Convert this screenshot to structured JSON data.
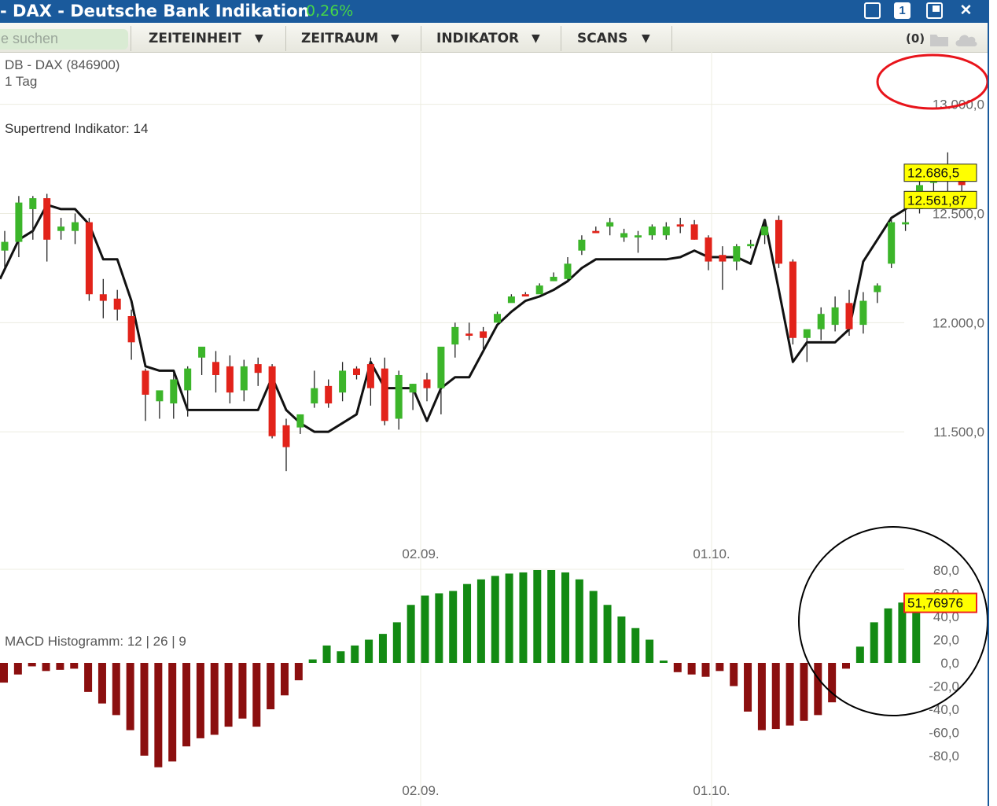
{
  "window": {
    "title": "- DAX - Deutsche Bank Indikation",
    "change": "0,26%",
    "btn_one": "1",
    "btn_close": "✕"
  },
  "toolbar": {
    "search_placeholder": "e suchen",
    "menu": [
      {
        "label": "ZEITEINHEIT",
        "arrow": "▼"
      },
      {
        "label": "ZEITRAUM",
        "arrow": "▼"
      },
      {
        "label": "INDIKATOR",
        "arrow": "▼"
      },
      {
        "label": "SCANS",
        "arrow": "▼"
      }
    ],
    "count": "(0)",
    "icons": [
      "folder-icon",
      "cloud-icon"
    ]
  },
  "colors": {
    "title_bar": "#1a5a9c",
    "up_candle": "#3cb52a",
    "down_candle": "#e2231a",
    "price_label": "#ffff00",
    "macd_positive": "#138a13",
    "macd_negative": "#8b0f0f",
    "annotation_red": "#e8141b",
    "annotation_black": "#000000"
  },
  "chart_data": [
    {
      "type": "candlestick",
      "title": "DB - DAX (846900)",
      "interval": "1 Tag",
      "indicator_label": "Supertrend Indikator: 14",
      "x_ticks": [
        "02.09.",
        "01.10."
      ],
      "y_ticks": [
        "13.000,0",
        "12.500,0",
        "12.000,0",
        "11.500,0"
      ],
      "ylim": [
        11000,
        13150
      ],
      "grid": true,
      "last_price_labels": [
        "12.686,5",
        "12.561,87"
      ],
      "candles": [
        {
          "o": 12330,
          "h": 12420,
          "l": 12250,
          "c": 12370
        },
        {
          "o": 12370,
          "h": 12580,
          "l": 12300,
          "c": 12550
        },
        {
          "o": 12520,
          "h": 12580,
          "l": 12380,
          "c": 12570
        },
        {
          "o": 12570,
          "h": 12590,
          "l": 12280,
          "c": 12380
        },
        {
          "o": 12420,
          "h": 12480,
          "l": 12380,
          "c": 12440
        },
        {
          "o": 12420,
          "h": 12500,
          "l": 12360,
          "c": 12460
        },
        {
          "o": 12460,
          "h": 12480,
          "l": 12100,
          "c": 12130
        },
        {
          "o": 12130,
          "h": 12200,
          "l": 12020,
          "c": 12100
        },
        {
          "o": 12110,
          "h": 12150,
          "l": 12010,
          "c": 12060
        },
        {
          "o": 12030,
          "h": 12060,
          "l": 11830,
          "c": 11910
        },
        {
          "o": 11780,
          "h": 11790,
          "l": 11550,
          "c": 11670
        },
        {
          "o": 11640,
          "h": 11680,
          "l": 11560,
          "c": 11690
        },
        {
          "o": 11630,
          "h": 11770,
          "l": 11560,
          "c": 11740
        },
        {
          "o": 11690,
          "h": 11800,
          "l": 11570,
          "c": 11790
        },
        {
          "o": 11840,
          "h": 11860,
          "l": 11760,
          "c": 11890
        },
        {
          "o": 11820,
          "h": 11870,
          "l": 11680,
          "c": 11760
        },
        {
          "o": 11800,
          "h": 11850,
          "l": 11630,
          "c": 11680
        },
        {
          "o": 11690,
          "h": 11830,
          "l": 11640,
          "c": 11800
        },
        {
          "o": 11810,
          "h": 11840,
          "l": 11710,
          "c": 11770
        },
        {
          "o": 11800,
          "h": 11810,
          "l": 11470,
          "c": 11480
        },
        {
          "o": 11530,
          "h": 11560,
          "l": 11320,
          "c": 11430
        },
        {
          "o": 11520,
          "h": 11580,
          "l": 11490,
          "c": 11580
        },
        {
          "o": 11630,
          "h": 11780,
          "l": 11610,
          "c": 11700
        },
        {
          "o": 11710,
          "h": 11740,
          "l": 11610,
          "c": 11630
        },
        {
          "o": 11680,
          "h": 11820,
          "l": 11640,
          "c": 11780
        },
        {
          "o": 11790,
          "h": 11800,
          "l": 11740,
          "c": 11760
        },
        {
          "o": 11810,
          "h": 11840,
          "l": 11620,
          "c": 11700
        },
        {
          "o": 11790,
          "h": 11840,
          "l": 11530,
          "c": 11550
        },
        {
          "o": 11560,
          "h": 11780,
          "l": 11510,
          "c": 11760
        },
        {
          "o": 11680,
          "h": 11720,
          "l": 11600,
          "c": 11720
        },
        {
          "o": 11740,
          "h": 11770,
          "l": 11640,
          "c": 11700
        },
        {
          "o": 11700,
          "h": 11720,
          "l": 11580,
          "c": 11890
        },
        {
          "o": 11900,
          "h": 12000,
          "l": 11840,
          "c": 11980
        },
        {
          "o": 11950,
          "h": 12000,
          "l": 11920,
          "c": 11940
        },
        {
          "o": 11960,
          "h": 11980,
          "l": 11870,
          "c": 11930
        },
        {
          "o": 12000,
          "h": 12050,
          "l": 12020,
          "c": 12040
        },
        {
          "o": 12090,
          "h": 12130,
          "l": 12110,
          "c": 12120
        },
        {
          "o": 12130,
          "h": 12140,
          "l": 12130,
          "c": 12120
        },
        {
          "o": 12130,
          "h": 12180,
          "l": 12140,
          "c": 12170
        },
        {
          "o": 12190,
          "h": 12230,
          "l": 12190,
          "c": 12210
        },
        {
          "o": 12200,
          "h": 12300,
          "l": 12190,
          "c": 12270
        },
        {
          "o": 12330,
          "h": 12400,
          "l": 12310,
          "c": 12380
        },
        {
          "o": 12420,
          "h": 12440,
          "l": 12410,
          "c": 12410
        },
        {
          "o": 12440,
          "h": 12480,
          "l": 12400,
          "c": 12460
        },
        {
          "o": 12390,
          "h": 12430,
          "l": 12370,
          "c": 12410
        },
        {
          "o": 12390,
          "h": 12420,
          "l": 12320,
          "c": 12400
        },
        {
          "o": 12400,
          "h": 12450,
          "l": 12380,
          "c": 12440
        },
        {
          "o": 12400,
          "h": 12460,
          "l": 12380,
          "c": 12440
        },
        {
          "o": 12450,
          "h": 12480,
          "l": 12410,
          "c": 12440
        },
        {
          "o": 12450,
          "h": 12470,
          "l": 12380,
          "c": 12380
        },
        {
          "o": 12390,
          "h": 12400,
          "l": 12240,
          "c": 12280
        },
        {
          "o": 12310,
          "h": 12350,
          "l": 12150,
          "c": 12280
        },
        {
          "o": 12280,
          "h": 12360,
          "l": 12240,
          "c": 12350
        },
        {
          "o": 12350,
          "h": 12380,
          "l": 12340,
          "c": 12360
        },
        {
          "o": 12400,
          "h": 12470,
          "l": 12360,
          "c": 12440
        },
        {
          "o": 12470,
          "h": 12490,
          "l": 12250,
          "c": 12270
        },
        {
          "o": 12280,
          "h": 12290,
          "l": 11900,
          "c": 11930
        },
        {
          "o": 11930,
          "h": 11960,
          "l": 11820,
          "c": 11970
        },
        {
          "o": 11970,
          "h": 12070,
          "l": 11920,
          "c": 12040
        },
        {
          "o": 11990,
          "h": 12120,
          "l": 11960,
          "c": 12070
        },
        {
          "o": 12090,
          "h": 12150,
          "l": 11940,
          "c": 11970
        },
        {
          "o": 11990,
          "h": 12140,
          "l": 11950,
          "c": 12100
        },
        {
          "o": 12140,
          "h": 12180,
          "l": 12090,
          "c": 12170
        },
        {
          "o": 12270,
          "h": 12480,
          "l": 12250,
          "c": 12460
        },
        {
          "o": 12450,
          "h": 12520,
          "l": 12420,
          "c": 12460
        },
        {
          "o": 12520,
          "h": 12660,
          "l": 12500,
          "c": 12630
        },
        {
          "o": 12640,
          "h": 12700,
          "l": 12560,
          "c": 12690
        },
        {
          "o": 12680,
          "h": 12780,
          "l": 12600,
          "c": 12700
        },
        {
          "o": 12690,
          "h": 12710,
          "l": 12580,
          "c": 12630
        }
      ],
      "supertrend": [
        12200,
        12380,
        12420,
        12540,
        12520,
        12520,
        12450,
        12290,
        12290,
        12100,
        11800,
        11780,
        11780,
        11600,
        11600,
        11600,
        11600,
        11600,
        11600,
        11750,
        11600,
        11540,
        11500,
        11500,
        11540,
        11580,
        11820,
        11700,
        11700,
        11700,
        11550,
        11700,
        11750,
        11750,
        11870,
        11990,
        12050,
        12100,
        12120,
        12150,
        12190,
        12250,
        12290,
        12290,
        12290,
        12290,
        12290,
        12290,
        12300,
        12330,
        12300,
        12300,
        12300,
        12270,
        12470,
        12150,
        11820,
        11910,
        11910,
        11910,
        11970,
        12280,
        12380,
        12480,
        12520,
        12570,
        12570,
        12570,
        12580
      ]
    },
    {
      "type": "bar",
      "title": "MACD Histogramm: 12 | 26 | 9",
      "x_ticks": [
        "02.09.",
        "01.10."
      ],
      "y_ticks": [
        "80,0",
        "60,0",
        "40,0",
        "20,0",
        "0,0",
        "-20,0",
        "-40,0",
        "-60,0",
        "-80,0"
      ],
      "ylim": [
        -90,
        85
      ],
      "last_value_label": "51,76976",
      "values": [
        -17,
        -10,
        -3,
        -7,
        -6,
        -5,
        -25,
        -35,
        -45,
        -58,
        -80,
        -90,
        -85,
        -72,
        -65,
        -62,
        -55,
        -48,
        -55,
        -40,
        -28,
        -15,
        3,
        15,
        10,
        15,
        20,
        25,
        35,
        50,
        58,
        60,
        62,
        68,
        72,
        75,
        77,
        78,
        80,
        80,
        78,
        72,
        62,
        50,
        40,
        30,
        20,
        2,
        -8,
        -10,
        -12,
        -7,
        -20,
        -42,
        -58,
        -57,
        -54,
        -50,
        -45,
        -34,
        -5,
        14,
        35,
        47,
        52,
        52
      ]
    }
  ],
  "annotations": [
    {
      "kind": "ellipse",
      "color": "red",
      "encircles": "13.000,0"
    },
    {
      "kind": "circle",
      "color": "black",
      "encircles": "51,76976"
    }
  ]
}
